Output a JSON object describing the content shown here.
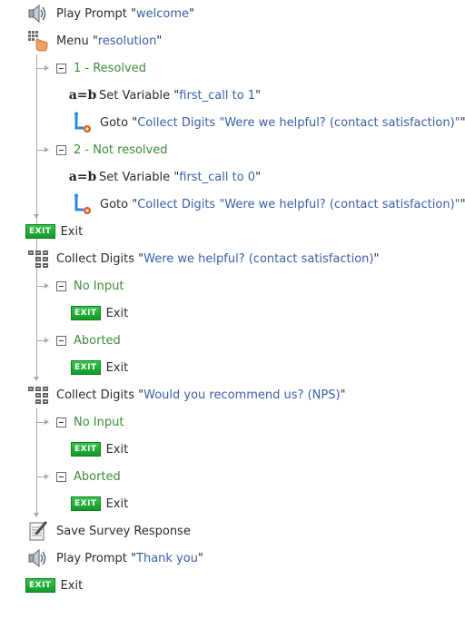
{
  "flow": {
    "n1": {
      "label": "Play Prompt",
      "value": "welcome"
    },
    "n2": {
      "label": "Menu",
      "value": "resolution"
    },
    "b1": {
      "label": "1 - Resolved"
    },
    "b1_set": {
      "label": "Set Variable",
      "value": "first_call to 1"
    },
    "b1_goto": {
      "label": "Goto",
      "value": "Collect Digits \"Were we helpful? (contact satisfaction)\""
    },
    "b2": {
      "label": "2 - Not resolved"
    },
    "b2_set": {
      "label": "Set Variable",
      "value": "first_call to 0"
    },
    "b2_goto": {
      "label": "Goto",
      "value": "Collect Digits \"Were we helpful? (contact satisfaction)\""
    },
    "exit1": {
      "label": "Exit",
      "badge": "EXIT"
    },
    "n3": {
      "label": "Collect Digits",
      "value": "Were we helpful? (contact satisfaction)"
    },
    "n3_noinput": {
      "label": "No Input"
    },
    "n3_noinput_exit": {
      "label": "Exit",
      "badge": "EXIT"
    },
    "n3_aborted": {
      "label": "Aborted"
    },
    "n3_aborted_exit": {
      "label": "Exit",
      "badge": "EXIT"
    },
    "n4": {
      "label": "Collect Digits",
      "value": "Would you recommend us? (NPS)"
    },
    "n4_noinput": {
      "label": "No Input"
    },
    "n4_noinput_exit": {
      "label": "Exit",
      "badge": "EXIT"
    },
    "n4_aborted": {
      "label": "Aborted"
    },
    "n4_aborted_exit": {
      "label": "Exit",
      "badge": "EXIT"
    },
    "n5": {
      "label": "Save Survey Response"
    },
    "n6": {
      "label": "Play Prompt",
      "value": "Thank you"
    },
    "exit2": {
      "label": "Exit",
      "badge": "EXIT"
    }
  },
  "icons": {
    "speaker": "speaker-icon",
    "menu": "menu-keypad-hand-icon",
    "set_variable": "set-variable-ab-icon",
    "goto": "goto-arrow-icon",
    "exit": "exit-badge-icon",
    "collect_digits": "keypad-digits-icon",
    "save_survey": "notepad-pencil-icon"
  },
  "colors": {
    "value_text": "#3a5fa8",
    "branch_text": "#3c8c3c",
    "exit_green": "#1faa35",
    "tree_line": "#a9a9a9"
  }
}
